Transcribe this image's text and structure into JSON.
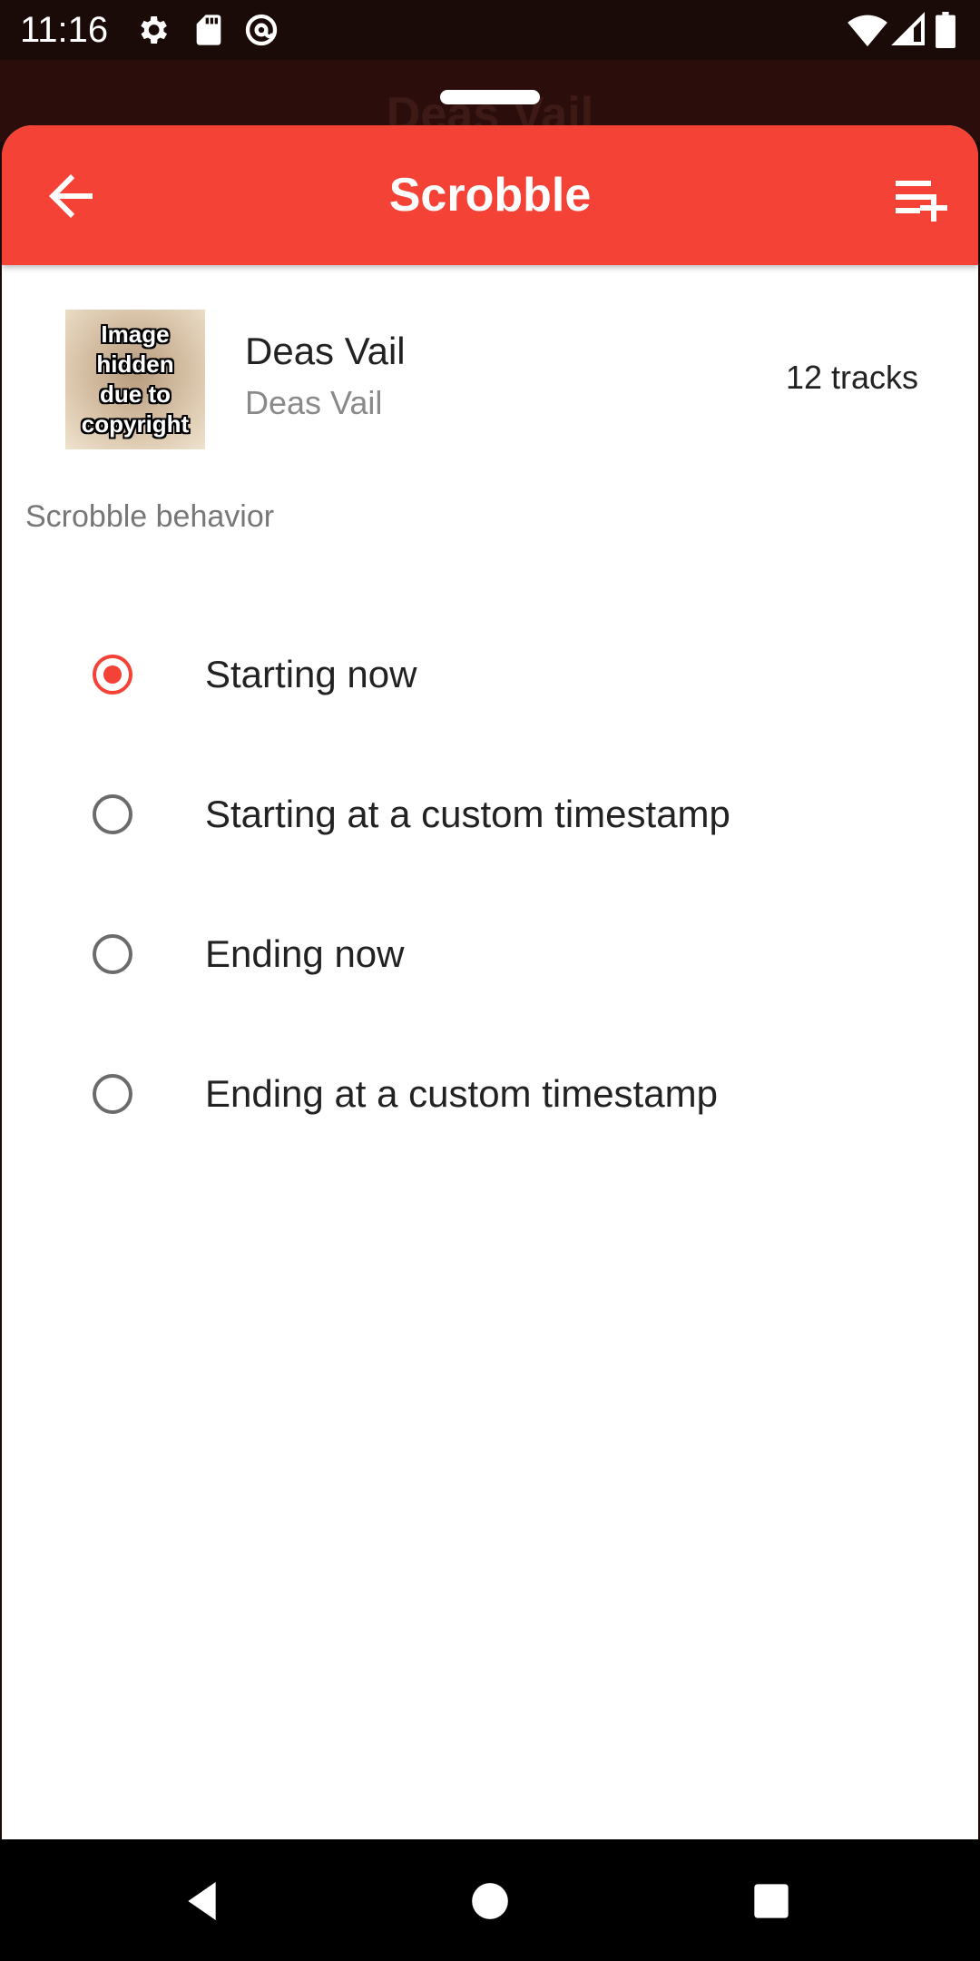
{
  "status_bar": {
    "time": "11:16",
    "left_icons": [
      "settings-icon",
      "sd-card-icon",
      "at-sign-icon"
    ],
    "right_icons": [
      "wifi-icon",
      "signal-icon",
      "battery-icon"
    ]
  },
  "background_app": {
    "title": "Deas Vail"
  },
  "app_bar": {
    "title": "Scrobble",
    "back_icon": "arrow-back-icon",
    "action_icon": "playlist-add-icon",
    "color": "#f44336"
  },
  "album": {
    "art_text": "Image hidden due to copyright",
    "title": "Deas Vail",
    "artist": "Deas Vail",
    "track_count": "12 tracks"
  },
  "scrobble_behavior": {
    "label": "Scrobble behavior",
    "options": [
      {
        "label": "Starting now",
        "selected": true
      },
      {
        "label": "Starting at a custom timestamp",
        "selected": false
      },
      {
        "label": "Ending now",
        "selected": false
      },
      {
        "label": "Ending at a custom timestamp",
        "selected": false
      }
    ]
  },
  "nav_bar": {
    "buttons": [
      "back-triangle-icon",
      "home-circle-icon",
      "recents-square-icon"
    ]
  }
}
